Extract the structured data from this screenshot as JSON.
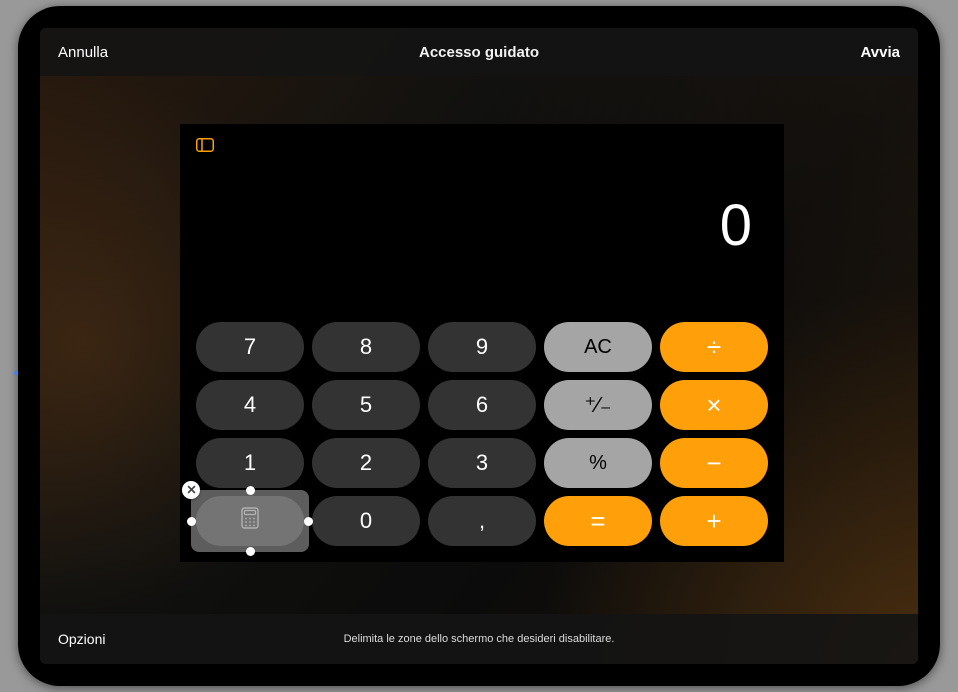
{
  "nav": {
    "cancel": "Annulla",
    "title": "Accesso guidato",
    "start": "Avvia"
  },
  "bottom": {
    "options": "Opzioni",
    "hint": "Delimita le zone dello schermo che desideri disabilitare."
  },
  "calculator": {
    "display": "0",
    "keys": {
      "k7": "7",
      "k8": "8",
      "k9": "9",
      "ac": "AC",
      "divide": "÷",
      "k4": "4",
      "k5": "5",
      "k6": "6",
      "plusminus": "⁺∕₋",
      "multiply": "×",
      "k1": "1",
      "k2": "2",
      "k3": "3",
      "percent": "%",
      "minus": "−",
      "calc": "",
      "k0": "0",
      "comma": ",",
      "equals": "=",
      "plus": "+"
    }
  },
  "colors": {
    "operator": "#ff9f0a",
    "function": "#a5a5a5",
    "number": "#333333",
    "accent_sidebar": "#ff9f0a"
  }
}
